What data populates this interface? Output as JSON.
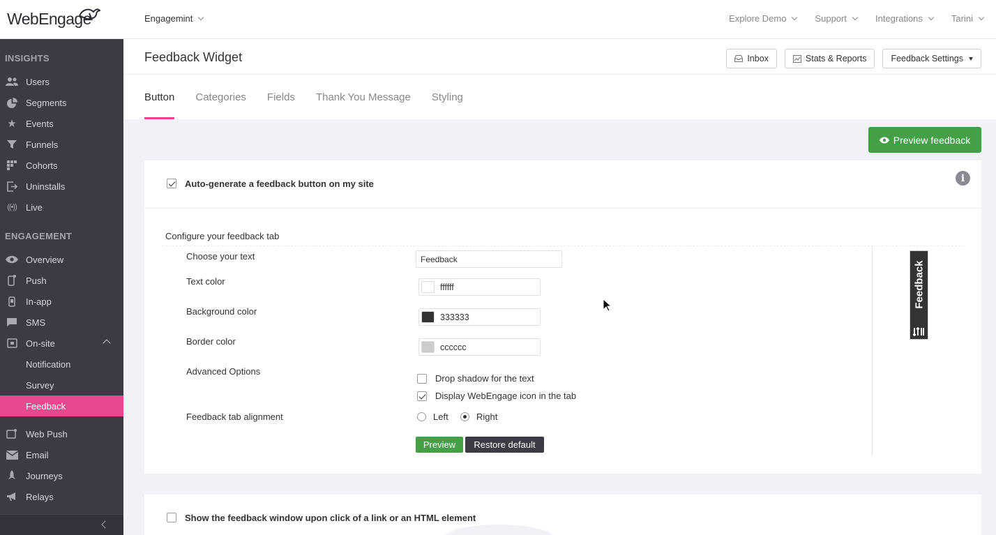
{
  "app": {
    "logo_text": "WebEngage",
    "project": "Engagemint"
  },
  "topnav": [
    {
      "label": "Explore Demo"
    },
    {
      "label": "Support"
    },
    {
      "label": "Integrations"
    },
    {
      "label": "Tarini"
    }
  ],
  "sidebar": {
    "insights_title": "INSIGHTS",
    "insights": [
      {
        "label": "Users",
        "icon": "users-icon"
      },
      {
        "label": "Segments",
        "icon": "pie-chart-icon"
      },
      {
        "label": "Events",
        "icon": "star-icon"
      },
      {
        "label": "Funnels",
        "icon": "funnel-icon"
      },
      {
        "label": "Cohorts",
        "icon": "grid-icon"
      },
      {
        "label": "Uninstalls",
        "icon": "exit-icon"
      },
      {
        "label": "Live",
        "icon": "broadcast-icon"
      }
    ],
    "engagement_title": "ENGAGEMENT",
    "engagement": [
      {
        "label": "Overview",
        "icon": "eye-icon"
      },
      {
        "label": "Push",
        "icon": "mobile-push-icon"
      },
      {
        "label": "In-app",
        "icon": "mobile-icon"
      },
      {
        "label": "SMS",
        "icon": "sms-icon"
      },
      {
        "label": "On-site",
        "icon": "onsite-icon"
      }
    ],
    "onsite_sub": [
      {
        "label": "Notification"
      },
      {
        "label": "Survey"
      },
      {
        "label": "Feedback"
      }
    ],
    "channels": [
      {
        "label": "Web Push",
        "icon": "web-push-icon"
      },
      {
        "label": "Email",
        "icon": "envelope-icon"
      },
      {
        "label": "Journeys",
        "icon": "rocket-icon"
      },
      {
        "label": "Relays",
        "icon": "megaphone-icon"
      }
    ]
  },
  "header": {
    "title": "Feedback Widget",
    "buttons": {
      "inbox": "Inbox",
      "stats": "Stats & Reports",
      "settings": "Feedback Settings"
    },
    "tabs": [
      "Button",
      "Categories",
      "Fields",
      "Thank You Message",
      "Styling"
    ],
    "active_tab": "Button"
  },
  "preview_feedback": "Preview feedback",
  "card": {
    "auto_generate_label": "Auto-generate a feedback button on my site",
    "auto_generate_checked": true,
    "configure_title": "Configure your feedback tab",
    "rows": {
      "text_label": "Choose your text",
      "text_value": "Feedback",
      "text_color_label": "Text color",
      "text_color_value": "ffffff",
      "bg_color_label": "Background color",
      "bg_color_value": "333333",
      "border_color_label": "Border color",
      "border_color_value": "cccccc",
      "advanced_label": "Advanced Options",
      "drop_shadow_label": "Drop shadow for the text",
      "drop_shadow_checked": false,
      "display_icon_label": "Display WebEngage icon in the tab",
      "display_icon_checked": true,
      "alignment_label": "Feedback tab alignment",
      "align_left": "Left",
      "align_right": "Right",
      "alignment_selected": "Right"
    },
    "preview_btn": "Preview",
    "restore_btn": "Restore default",
    "tab_preview_text": "Feedback"
  },
  "card2": {
    "show_window_label": "Show the feedback window upon click of a link or an HTML element",
    "show_window_checked": false
  },
  "colors": {
    "accent": "#e8488d",
    "green": "#43a047",
    "sidebar": "#3b3b45"
  }
}
